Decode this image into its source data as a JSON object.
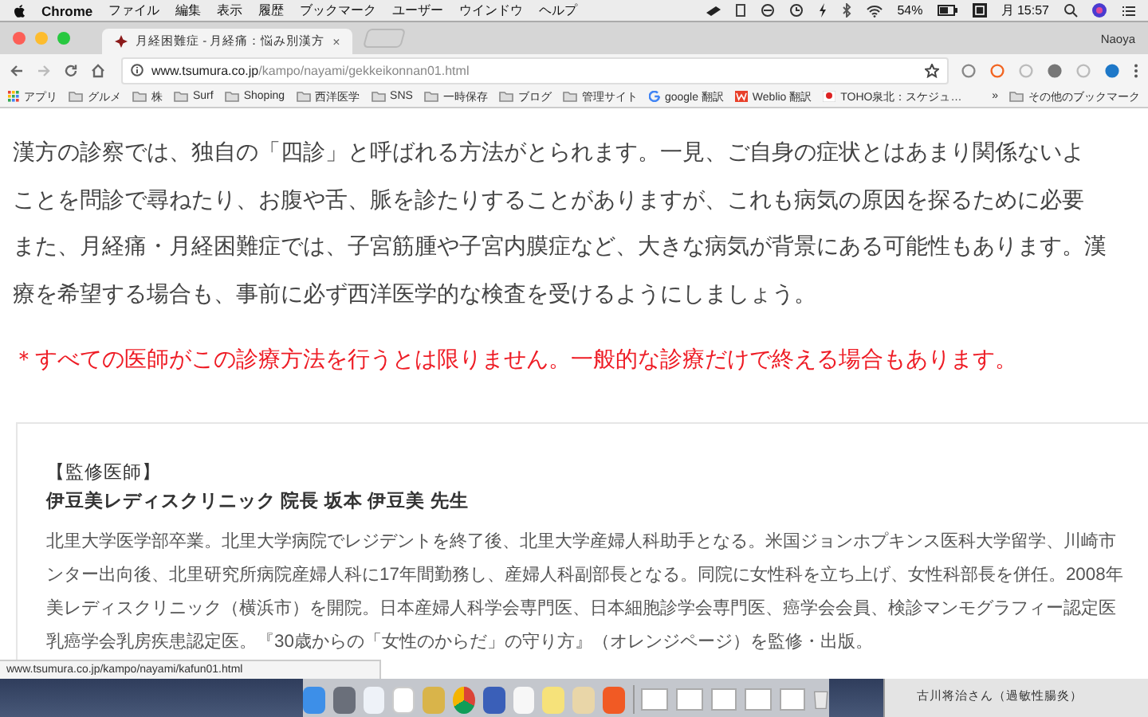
{
  "menubar": {
    "app": "Chrome",
    "menus": [
      "ファイル",
      "編集",
      "表示",
      "履歴",
      "ブックマーク",
      "ユーザー",
      "ウインドウ",
      "ヘルプ"
    ],
    "battery": "54%",
    "clock": "月 15:57"
  },
  "tabs": [
    {
      "title": "月経困難症 - 月経痛：悩み別漢方",
      "selected": true,
      "close": "×"
    }
  ],
  "profile": "Naoya",
  "address": {
    "host": "www.tsumura.co.jp",
    "path": "/kampo/nayami/gekkeikonnan01.html"
  },
  "bookmarks": [
    {
      "label": "アプリ",
      "kind": "apps"
    },
    {
      "label": "グルメ",
      "kind": "folder"
    },
    {
      "label": "株",
      "kind": "folder"
    },
    {
      "label": "Surf",
      "kind": "folder"
    },
    {
      "label": "Shoping",
      "kind": "folder"
    },
    {
      "label": "西洋医学",
      "kind": "folder"
    },
    {
      "label": "SNS",
      "kind": "folder"
    },
    {
      "label": "一時保存",
      "kind": "folder"
    },
    {
      "label": "ブログ",
      "kind": "folder"
    },
    {
      "label": "管理サイト",
      "kind": "folder"
    },
    {
      "label": "google 翻訳",
      "kind": "google"
    },
    {
      "label": "Weblio 翻訳",
      "kind": "weblio"
    },
    {
      "label": "TOHO泉北：スケジュ…",
      "kind": "toho"
    }
  ],
  "bookmarks_overflow": "»",
  "other_bookmarks": "その他のブックマーク",
  "article": {
    "lines": [
      "漢方の診察では、独自の「四診」と呼ばれる方法がとられます。一見、ご自身の症状とはあまり関係ないよ",
      "ことを問診で尋ねたり、お腹や舌、脈を診たりすることがありますが、これも病気の原因を探るために必要",
      "また、月経痛・月経困難症では、子宮筋腫や子宮内膜症など、大きな病気が背景にある可能性もあります。漢",
      "療を希望する場合も、事前に必ず西洋医学的な検査を受けるようにしましょう。"
    ],
    "note": "＊すべての医師がこの診療方法を行うとは限りません。一般的な診療だけで終える場合もあります。"
  },
  "supervisor": {
    "heading": "【監修医師】",
    "name": "伊豆美レディスクリニック 院長 坂本 伊豆美 先生",
    "bio_lines": [
      "北里大学医学部卒業。北里大学病院でレジデントを終了後、北里大学産婦人科助手となる。米国ジョンホプキンス医科大学留学、川崎市",
      "ンター出向後、北里研究所病院産婦人科に17年間勤務し、産婦人科副部長となる。同院に女性科を立ち上げ、女性科部長を併任。2008年",
      "美レディスクリニック（横浜市）を開院。日本産婦人科学会専門医、日本細胞診学会専門医、癌学会会員、検診マンモグラフィー認定医",
      "乳癌学会乳房疾患認定医。『30歳からの「女性のからだ」の守り方』（オレンジページ）を監修・出版。"
    ]
  },
  "status_url": "www.tsumura.co.jp/kampo/nayami/kafun01.html",
  "background_window": {
    "text": "古川将治さん（過敏性腸炎）"
  }
}
